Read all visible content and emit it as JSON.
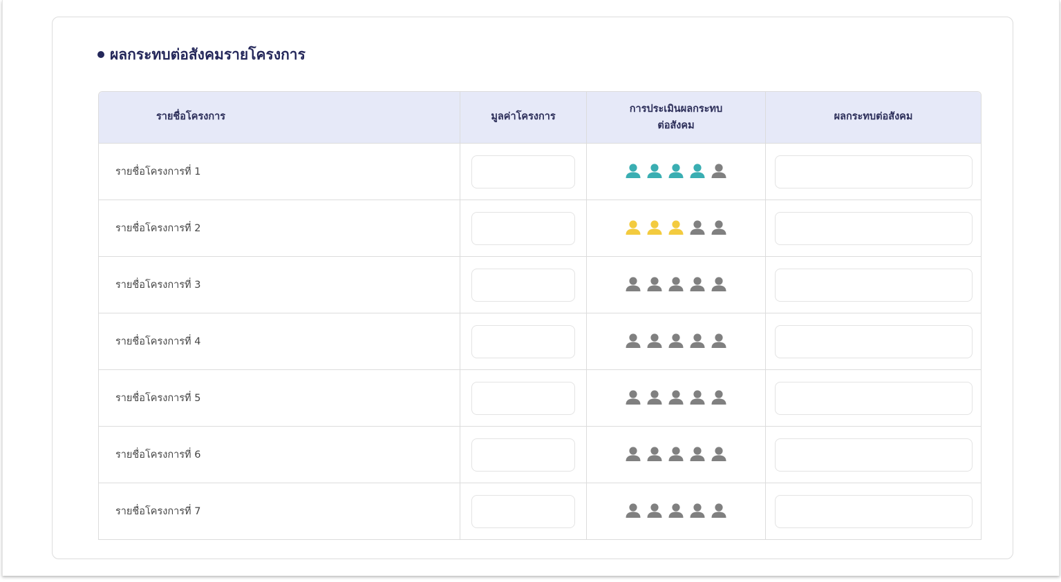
{
  "section": {
    "title": "ผลกระทบต่อสังคมรายโครงการ"
  },
  "table": {
    "headers": {
      "name": "รายชื่อโครงการ",
      "value": "มูลค่าโครงการ",
      "assessment_line1": "การประเมินผลกระทบ",
      "assessment_line2": "ต่อสังคม",
      "impact": "ผลกระทบต่อสังคม"
    },
    "rows": [
      {
        "name": "รายชื่อโครงการที่ 1",
        "rating": 4,
        "rating_color": "#3aaeb2",
        "value": "",
        "impact": ""
      },
      {
        "name": "รายชื่อโครงการที่ 2",
        "rating": 3,
        "rating_color": "#f3cb3f",
        "value": "",
        "impact": ""
      },
      {
        "name": "รายชื่อโครงการที่ 3",
        "rating": 0,
        "rating_color": "#808080",
        "value": "",
        "impact": ""
      },
      {
        "name": "รายชื่อโครงการที่ 4",
        "rating": 0,
        "rating_color": "#808080",
        "value": "",
        "impact": ""
      },
      {
        "name": "รายชื่อโครงการที่ 5",
        "rating": 0,
        "rating_color": "#808080",
        "value": "",
        "impact": ""
      },
      {
        "name": "รายชื่อโครงการที่ 6",
        "rating": 0,
        "rating_color": "#808080",
        "value": "",
        "impact": ""
      },
      {
        "name": "รายชื่อโครงการที่ 7",
        "rating": 0,
        "rating_color": "#808080",
        "value": "",
        "impact": ""
      }
    ],
    "rating_max": 5,
    "inactive_color": "#808080",
    "icon": "person-icon"
  }
}
